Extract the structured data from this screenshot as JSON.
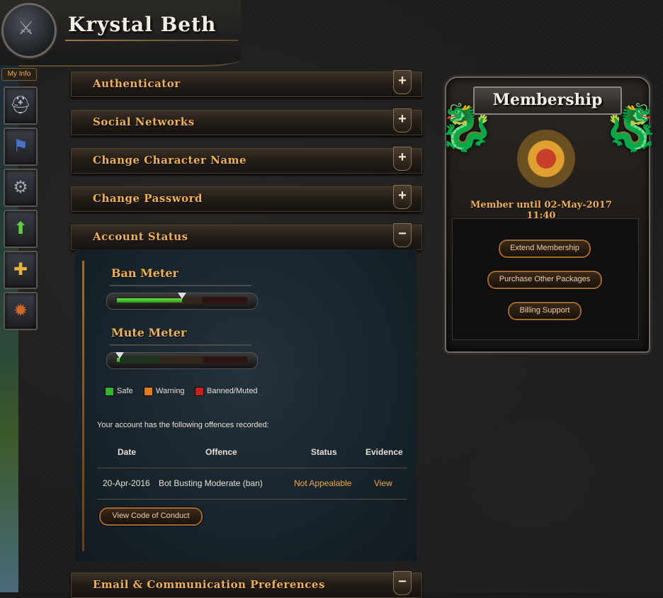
{
  "header": {
    "player_name": "Krystal Beth"
  },
  "nav": {
    "my_info_label": "My Info",
    "icons": [
      "helmet-icon",
      "banner-icon",
      "gear-icon",
      "rank-up-icon",
      "add-friend-icon",
      "bomb-icon"
    ]
  },
  "sections": [
    {
      "title": "Authenticator",
      "toggle": "+"
    },
    {
      "title": "Social Networks",
      "toggle": "+"
    },
    {
      "title": "Change Character Name",
      "toggle": "+"
    },
    {
      "title": "Change Password",
      "toggle": "+"
    },
    {
      "title": "Account Status",
      "toggle": "−"
    },
    {
      "title": "Email & Communication Preferences",
      "toggle": "−"
    }
  ],
  "account_status": {
    "ban_meter": {
      "label": "Ban Meter",
      "level": 0.5
    },
    "mute_meter": {
      "label": "Mute Meter",
      "level": 0.02
    },
    "legend": [
      {
        "label": "Safe",
        "color": "#2fb52a"
      },
      {
        "label": "Warning",
        "color": "#e07a1a"
      },
      {
        "label": "Banned/Muted",
        "color": "#c8201a"
      }
    ],
    "offence_intro": "Your account has the following offences recorded:",
    "table": {
      "headers": [
        "Date",
        "Offence",
        "Status",
        "Evidence"
      ],
      "rows": [
        {
          "date": "20-Apr-2016",
          "offence": "Bot Busting Moderate (ban)",
          "status": "Not Appealable",
          "evidence": "View"
        }
      ]
    },
    "code_of_conduct_button": "View Code of Conduct"
  },
  "membership": {
    "title": "Membership",
    "member_until": "Member until 02-May-2017 11:40",
    "buttons": {
      "extend": "Extend Membership",
      "purchase": "Purchase Other Packages",
      "billing": "Billing Support"
    }
  }
}
